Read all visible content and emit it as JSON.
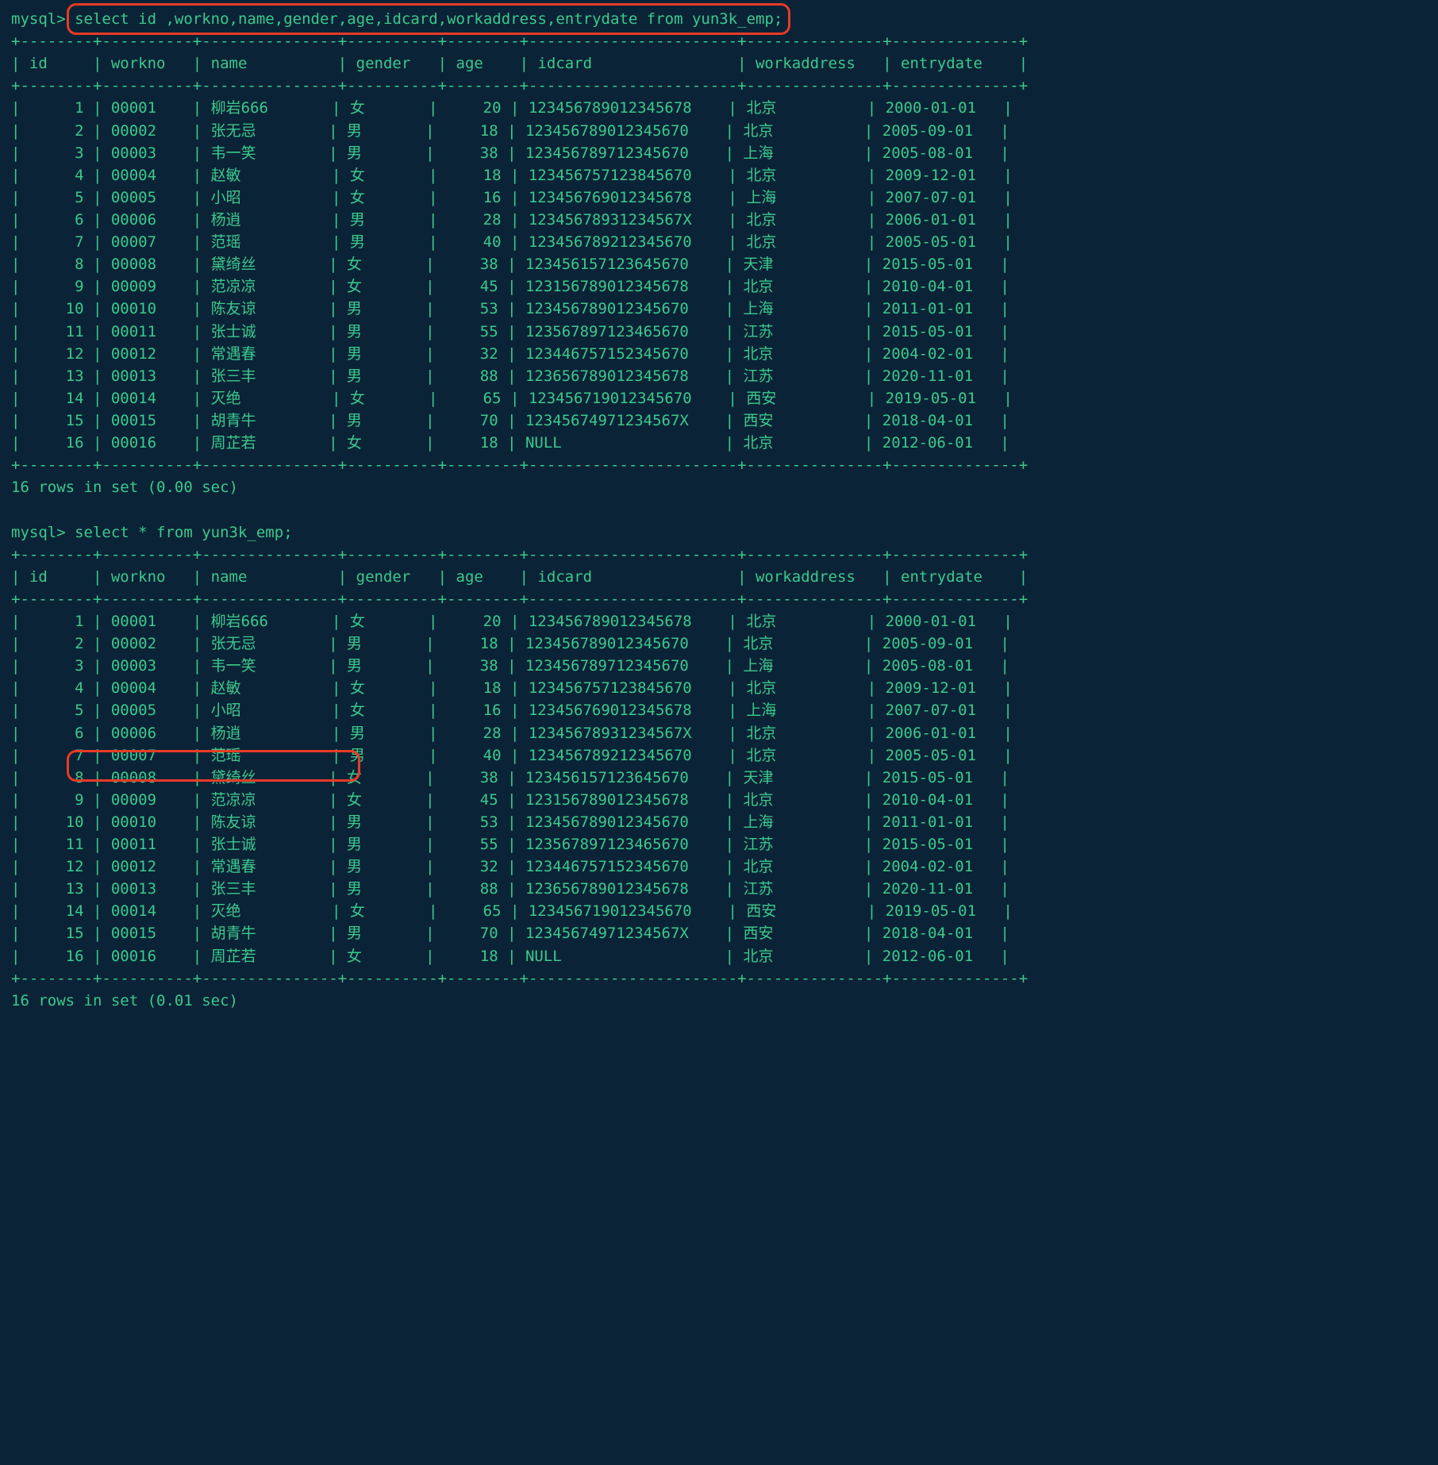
{
  "q1": {
    "prompt": "mysql>",
    "sql": "select id ,workno,name,gender,age,idcard,workaddress,entrydate from yun3k_emp;"
  },
  "q2": {
    "prompt": "mysql>",
    "sql": "select * from yun3k_emp;"
  },
  "footer1": "16 rows in set (0.00 sec)",
  "footer2": "16 rows in set (0.01 sec)",
  "columns": [
    "id",
    "workno",
    "name",
    "gender",
    "age",
    "idcard",
    "workaddress",
    "entrydate"
  ],
  "rows": [
    {
      "id": "1",
      "workno": "00001",
      "name": "柳岩666",
      "gender": "女",
      "age": "20",
      "idcard": "123456789012345678",
      "workaddress": "北京",
      "entrydate": "2000-01-01"
    },
    {
      "id": "2",
      "workno": "00002",
      "name": "张无忌",
      "gender": "男",
      "age": "18",
      "idcard": "123456789012345670",
      "workaddress": "北京",
      "entrydate": "2005-09-01"
    },
    {
      "id": "3",
      "workno": "00003",
      "name": "韦一笑",
      "gender": "男",
      "age": "38",
      "idcard": "123456789712345670",
      "workaddress": "上海",
      "entrydate": "2005-08-01"
    },
    {
      "id": "4",
      "workno": "00004",
      "name": "赵敏",
      "gender": "女",
      "age": "18",
      "idcard": "123456757123845670",
      "workaddress": "北京",
      "entrydate": "2009-12-01"
    },
    {
      "id": "5",
      "workno": "00005",
      "name": "小昭",
      "gender": "女",
      "age": "16",
      "idcard": "123456769012345678",
      "workaddress": "上海",
      "entrydate": "2007-07-01"
    },
    {
      "id": "6",
      "workno": "00006",
      "name": "杨逍",
      "gender": "男",
      "age": "28",
      "idcard": "12345678931234567X",
      "workaddress": "北京",
      "entrydate": "2006-01-01"
    },
    {
      "id": "7",
      "workno": "00007",
      "name": "范瑶",
      "gender": "男",
      "age": "40",
      "idcard": "123456789212345670",
      "workaddress": "北京",
      "entrydate": "2005-05-01"
    },
    {
      "id": "8",
      "workno": "00008",
      "name": "黛绮丝",
      "gender": "女",
      "age": "38",
      "idcard": "123456157123645670",
      "workaddress": "天津",
      "entrydate": "2015-05-01"
    },
    {
      "id": "9",
      "workno": "00009",
      "name": "范凉凉",
      "gender": "女",
      "age": "45",
      "idcard": "123156789012345678",
      "workaddress": "北京",
      "entrydate": "2010-04-01"
    },
    {
      "id": "10",
      "workno": "00010",
      "name": "陈友谅",
      "gender": "男",
      "age": "53",
      "idcard": "123456789012345670",
      "workaddress": "上海",
      "entrydate": "2011-01-01"
    },
    {
      "id": "11",
      "workno": "00011",
      "name": "张士诚",
      "gender": "男",
      "age": "55",
      "idcard": "123567897123465670",
      "workaddress": "江苏",
      "entrydate": "2015-05-01"
    },
    {
      "id": "12",
      "workno": "00012",
      "name": "常遇春",
      "gender": "男",
      "age": "32",
      "idcard": "123446757152345670",
      "workaddress": "北京",
      "entrydate": "2004-02-01"
    },
    {
      "id": "13",
      "workno": "00013",
      "name": "张三丰",
      "gender": "男",
      "age": "88",
      "idcard": "123656789012345678",
      "workaddress": "江苏",
      "entrydate": "2020-11-01"
    },
    {
      "id": "14",
      "workno": "00014",
      "name": "灭绝",
      "gender": "女",
      "age": "65",
      "idcard": "123456719012345670",
      "workaddress": "西安",
      "entrydate": "2019-05-01"
    },
    {
      "id": "15",
      "workno": "00015",
      "name": "胡青牛",
      "gender": "男",
      "age": "70",
      "idcard": "12345674971234567X",
      "workaddress": "西安",
      "entrydate": "2018-04-01"
    },
    {
      "id": "16",
      "workno": "00016",
      "name": "周芷若",
      "gender": "女",
      "age": "18",
      "idcard": "NULL",
      "workaddress": "北京",
      "entrydate": "2012-06-01"
    }
  ]
}
